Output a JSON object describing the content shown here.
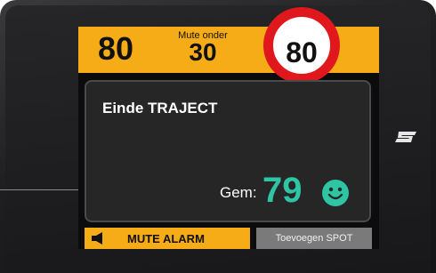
{
  "speed": {
    "current": "80"
  },
  "mute": {
    "label": "Mute onder",
    "value": "30"
  },
  "limit": {
    "value": "80"
  },
  "panel": {
    "title": "Einde TRAJECT",
    "avg_label": "Gem:",
    "avg_value": "79",
    "mood_icon": "smiley-face-icon"
  },
  "buttons": {
    "mute_alarm": "MUTE ALARM",
    "add_spot": "Toevoegen SPOT"
  },
  "colors": {
    "accent": "#f6ac16",
    "limit_ring": "#e0181e",
    "avg": "#2ec4a4",
    "spot_bg": "#7a7a7a"
  }
}
